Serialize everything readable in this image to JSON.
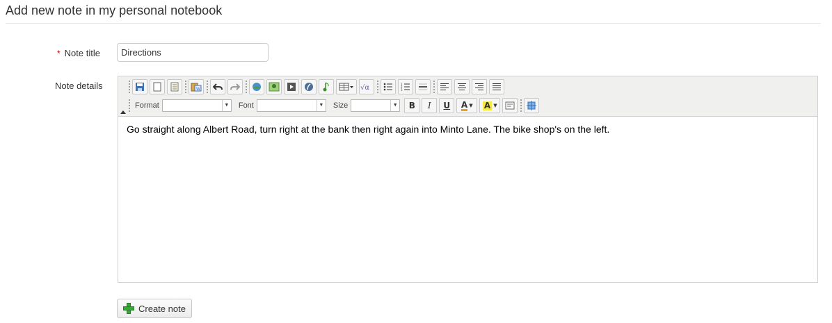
{
  "page": {
    "title": "Add new note in my personal notebook"
  },
  "form": {
    "required_marker": "*",
    "note_title_label": "Note title",
    "note_title_value": "Directions",
    "note_details_label": "Note details",
    "note_details_value": "Go straight along Albert Road, turn right at the bank then right again into Minto Lane. The bike shop's on the left.",
    "submit_label": "Create note"
  },
  "toolbar": {
    "row1_icons": [
      "save-icon",
      "new-document-icon",
      "templates-icon",
      "paste-from-word-icon",
      "undo-icon",
      "redo-icon",
      "insert-image-icon",
      "insert-picture-icon",
      "insert-media-icon",
      "insert-flash-icon",
      "insert-audio-icon",
      "table-icon",
      "equation-icon",
      "bulleted-list-icon",
      "numbered-list-icon",
      "horizontal-rule-icon",
      "align-left-icon",
      "align-center-icon",
      "align-right-icon",
      "justify-icon"
    ],
    "format_label": "Format",
    "format_value": "",
    "font_label": "Font",
    "font_value": "",
    "size_label": "Size",
    "size_value": "",
    "bold_glyph": "B",
    "italic_glyph": "I",
    "underline_glyph": "U",
    "text_color_glyph": "A",
    "highlight_glyph": "A"
  },
  "colors": {
    "required": "#cc0000",
    "toolbar_bg": "#f0f0ee",
    "add_icon": "#3aa63a"
  }
}
